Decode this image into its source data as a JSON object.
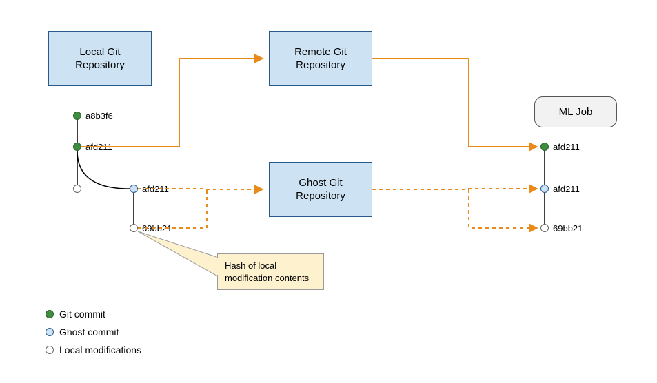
{
  "boxes": {
    "local": "Local Git\nRepository",
    "remote": "Remote Git\nRepository",
    "ghost": "Ghost Git\nRepository",
    "mljob": "ML Job"
  },
  "hashes": {
    "commit1": "a8b3f6",
    "commit2": "afd211",
    "ghost_commit": "afd211",
    "ghost_mod": "69bb21",
    "mljob_commit": "afd211",
    "mljob_ghost_commit": "afd211",
    "mljob_ghost_mod": "69bb21"
  },
  "callout": "Hash of local\nmodification contents",
  "legend": {
    "git_commit": "Git commit",
    "ghost_commit": "Ghost commit",
    "local_mod": "Local modifications"
  },
  "colors": {
    "orange": "#e88b1a",
    "box_fill": "#cde2f2",
    "box_border": "#2a5a8a"
  }
}
